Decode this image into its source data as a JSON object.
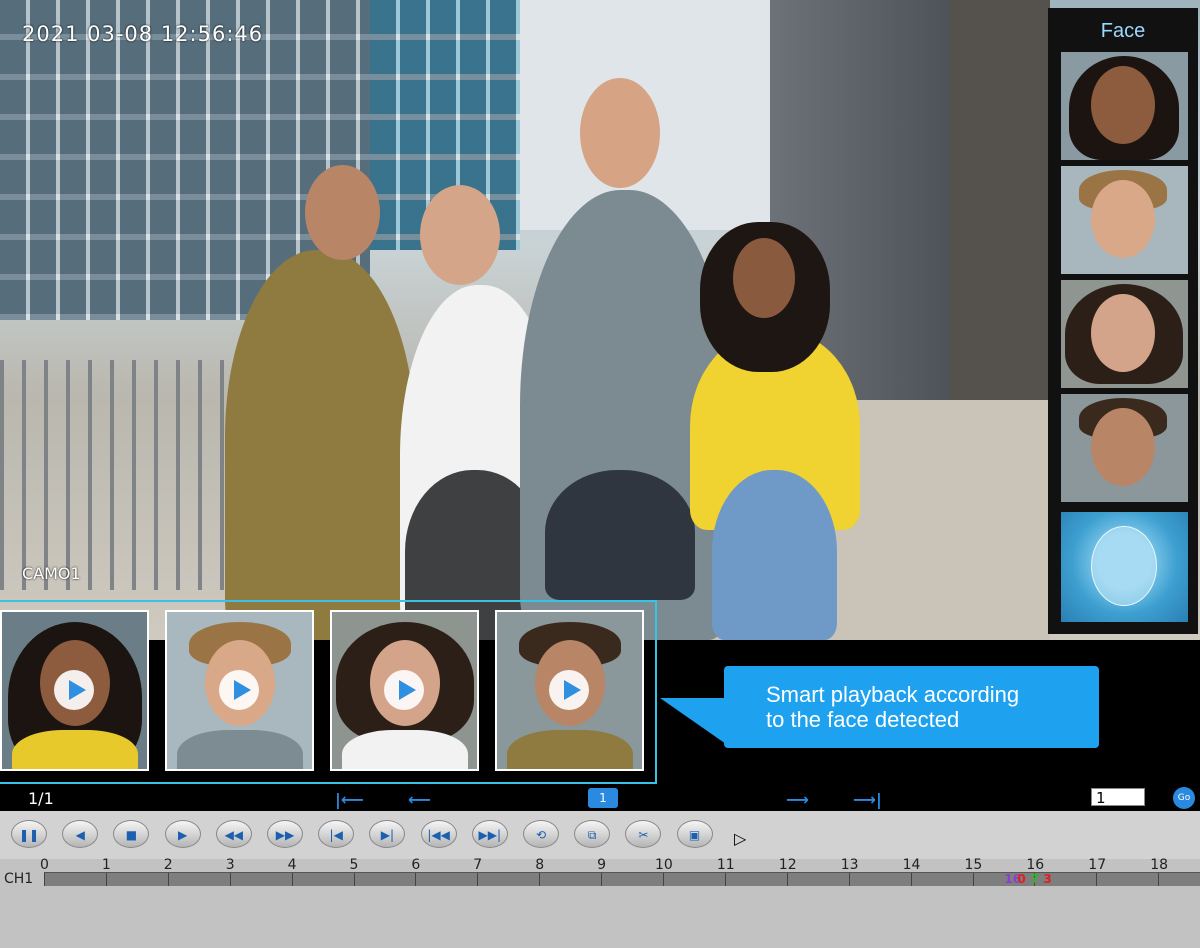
{
  "osd": {
    "datetime": "2021  03-08  12:56:46",
    "camera": "CAMO1"
  },
  "face_panel": {
    "title": "Face",
    "faces": [
      "face-1",
      "face-2",
      "face-3",
      "face-4",
      "face-scan"
    ]
  },
  "clips": [
    "clip-1",
    "clip-2",
    "clip-3",
    "clip-4"
  ],
  "callout": {
    "line1": "Smart playback according",
    "line2": "to the face detected"
  },
  "navbar": {
    "page": "1/1",
    "current_page_dot": "1",
    "jump_value": "1",
    "go_label": "Go"
  },
  "controls": [
    {
      "name": "pause-button",
      "glyph": "❚❚"
    },
    {
      "name": "reverse-play-button",
      "glyph": "◀"
    },
    {
      "name": "stop-button",
      "glyph": "■"
    },
    {
      "name": "play-button",
      "glyph": "▶"
    },
    {
      "name": "rewind-button",
      "glyph": "◀◀"
    },
    {
      "name": "fast-forward-button",
      "glyph": "▶▶"
    },
    {
      "name": "previous-frame-button",
      "glyph": "|◀"
    },
    {
      "name": "next-frame-button",
      "glyph": "▶|"
    },
    {
      "name": "previous-file-button",
      "glyph": "|◀◀"
    },
    {
      "name": "next-file-button",
      "glyph": "▶▶|"
    },
    {
      "name": "repeat-button",
      "glyph": "⟲"
    },
    {
      "name": "multi-window-button",
      "glyph": "⧉"
    },
    {
      "name": "clip-button",
      "glyph": "✂"
    },
    {
      "name": "save-button",
      "glyph": "▣"
    }
  ],
  "timeline": {
    "channel": "CH1",
    "hours": [
      "0",
      "1",
      "2",
      "3",
      "4",
      "5",
      "6",
      "7",
      "8",
      "9",
      "10",
      "11",
      "12",
      "13",
      "14",
      "15",
      "16",
      "17",
      "18"
    ],
    "record_segments": [
      {
        "label": "16",
        "color": "#8a3fd0"
      },
      {
        "label": "0",
        "color": "#e02020"
      },
      {
        "label": "7",
        "color": "#20c020"
      },
      {
        "label": "3",
        "color": "#e02020"
      }
    ]
  }
}
